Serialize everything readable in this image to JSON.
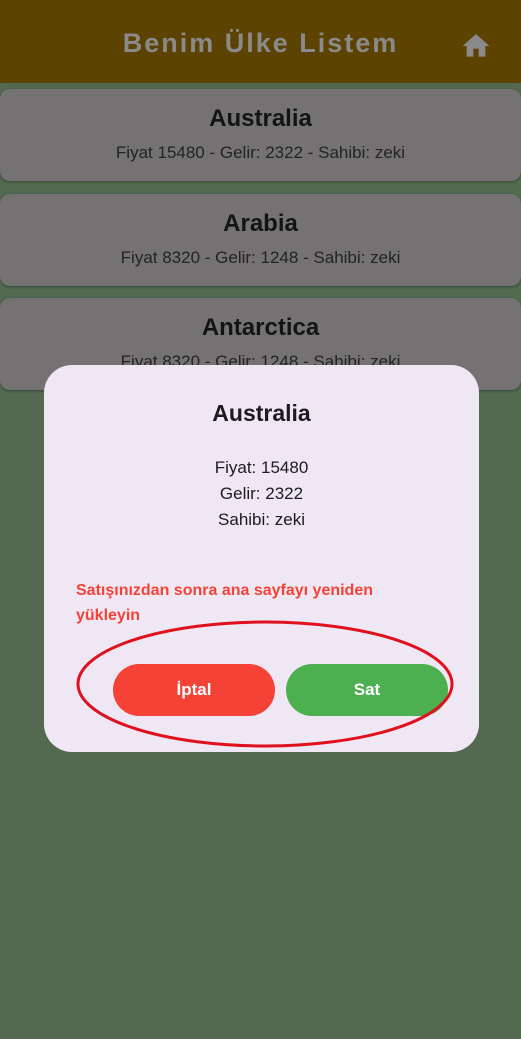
{
  "appbar": {
    "title": "Benim Ülke Listem",
    "home_icon": "home-icon"
  },
  "countries": [
    {
      "name": "Australia",
      "details": "Fiyat 15480 - Gelir: 2322 - Sahibi: zeki"
    },
    {
      "name": "Arabia",
      "details": "Fiyat 8320 - Gelir: 1248 - Sahibi: zeki"
    },
    {
      "name": "Antarctica",
      "details": "Fiyat 8320 - Gelir: 1248 - Sahibi: zeki"
    }
  ],
  "dialog": {
    "title": "Australia",
    "price": "Fiyat: 15480",
    "income": "Gelir: 2322",
    "owner": "Sahibi: zeki",
    "warning": "Satışınızdan sonra ana sayfayı yeniden yükleyin",
    "cancel_label": "İptal",
    "sell_label": "Sat"
  },
  "colors": {
    "appbar": "#5c4301",
    "background": "#536a51",
    "card": "#757273",
    "dialog": "#efe8f4",
    "cancel": "#f44336",
    "sell": "#4caf50",
    "annotation": "#e0101f"
  }
}
